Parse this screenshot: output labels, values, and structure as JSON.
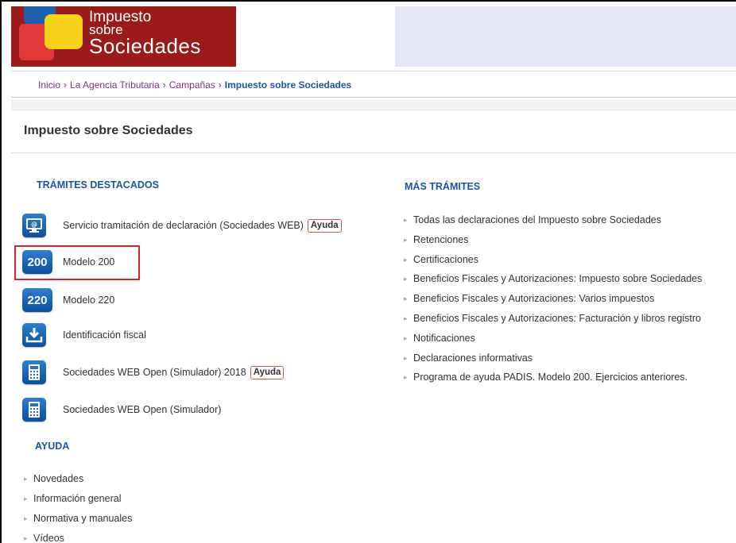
{
  "header": {
    "brand_line1": "Impuesto",
    "brand_line2": "sobre",
    "brand_line3": "Sociedades",
    "brand_color": "#9b1b1b"
  },
  "breadcrumb": {
    "items": [
      "Inicio",
      "La Agencia Tributaria",
      "Campañas"
    ],
    "current": "Impuesto sobre Sociedades",
    "separator": "›"
  },
  "page": {
    "title": "Impuesto sobre Sociedades"
  },
  "destacados": {
    "heading": "TRÁMITES DESTACADOS",
    "items": [
      {
        "label": "Servicio tramitación de declaración (Sociedades WEB)",
        "badge": "Ayuda",
        "icon": "monitor-icon"
      },
      {
        "label": "Modelo 200",
        "icon_text": "200",
        "icon": "modelo-200-icon"
      },
      {
        "label": "Modelo 220",
        "icon_text": "220",
        "icon": "modelo-220-icon"
      },
      {
        "label": "Identificación fiscal",
        "icon": "download-icon"
      },
      {
        "label": "Sociedades WEB Open (Simulador) 2018",
        "badge": "Ayuda",
        "icon": "calculator-icon"
      },
      {
        "label": "Sociedades WEB Open (Simulador)",
        "icon": "calculator-icon"
      }
    ]
  },
  "mas_tramites": {
    "heading": "MÁS TRÁMITES",
    "items": [
      "Todas las declaraciones del Impuesto sobre Sociedades",
      "Retenciones",
      "Certificaciones",
      "Beneficios Fiscales y Autorizaciones: Impuesto sobre Sociedades",
      "Beneficios Fiscales y Autorizaciones: Varios impuestos",
      "Beneficios Fiscales y Autorizaciones: Facturación y libros registro",
      "Notificaciones",
      "Declaraciones informativas",
      "Programa de ayuda PADIS. Modelo 200. Ejercicios anteriores."
    ]
  },
  "ayuda": {
    "heading": "AYUDA",
    "items": [
      "Novedades",
      "Información general",
      "Normativa y manuales",
      "Vídeos"
    ]
  },
  "colors": {
    "link_blue": "#1a56a4",
    "crumb_purple": "#8a2e8f",
    "highlight_red": "#d9252b",
    "header_fill": "#e5e6f6"
  }
}
